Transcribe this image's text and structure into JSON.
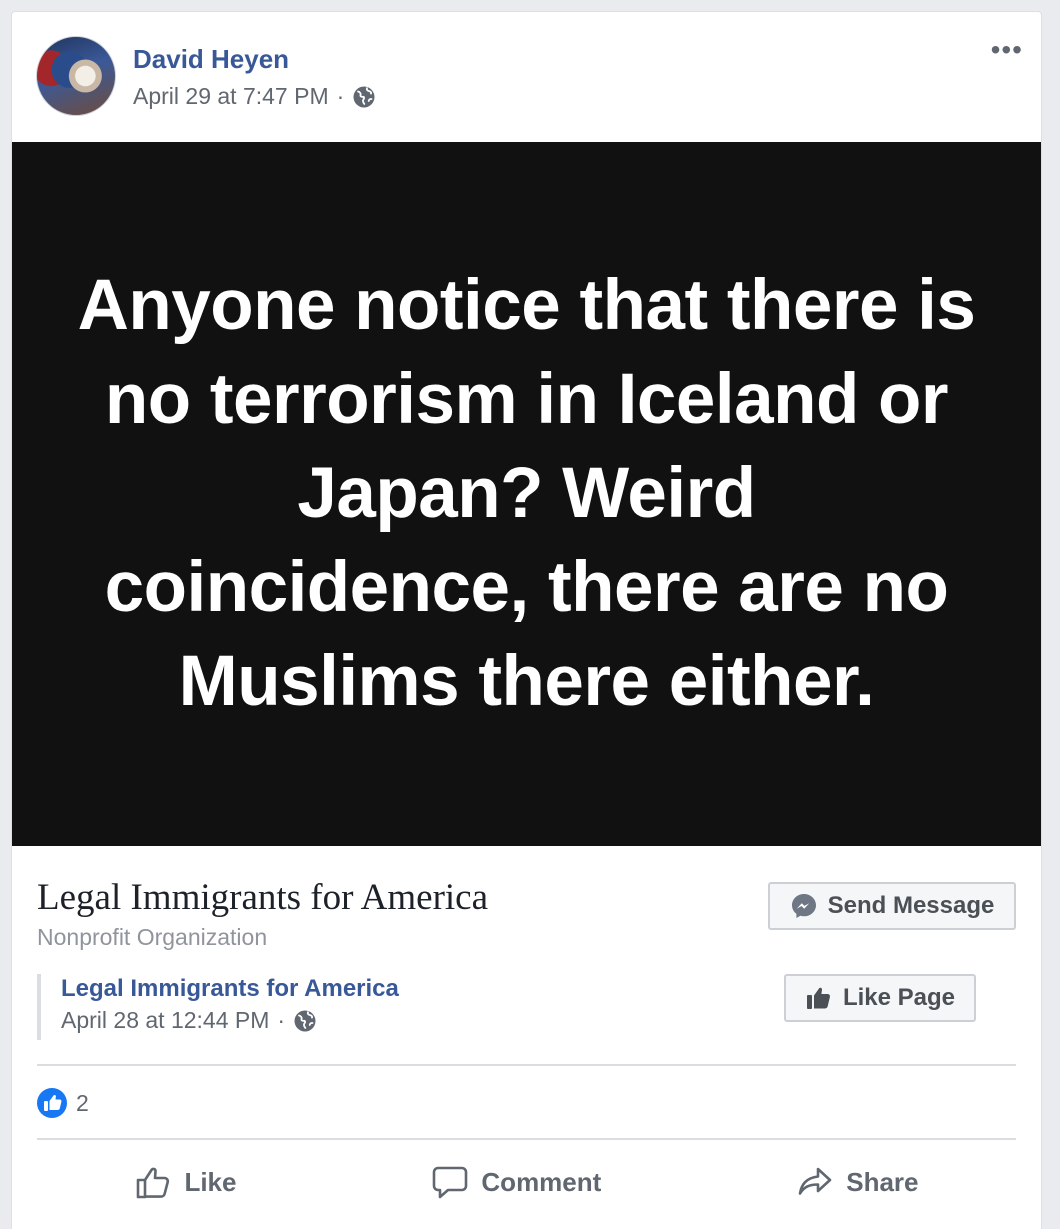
{
  "post": {
    "author": "David Heyen",
    "timestamp": "April 29 at 7:47 PM",
    "separator": "·",
    "privacy_icon": "globe-icon",
    "more_label": "•••",
    "image_text": "Anyone notice that there is no terrorism in Iceland or Japan? Weird coincidence, there are no Muslims there either."
  },
  "shared_page": {
    "name": "Legal Immigrants for America",
    "category": "Nonprofit Organization",
    "send_message_label": "Send Message",
    "like_page_label": "Like Page",
    "quote": {
      "name": "Legal Immigrants for America",
      "timestamp": "April 28 at 12:44 PM",
      "separator": "·"
    }
  },
  "reactions": {
    "count": "2",
    "icon": "like-badge-icon"
  },
  "actions": {
    "like_label": "Like",
    "comment_label": "Comment",
    "share_label": "Share"
  },
  "colors": {
    "link": "#385898",
    "meta": "#616770",
    "image_bg": "#111111",
    "like_blue": "#1877f2"
  }
}
